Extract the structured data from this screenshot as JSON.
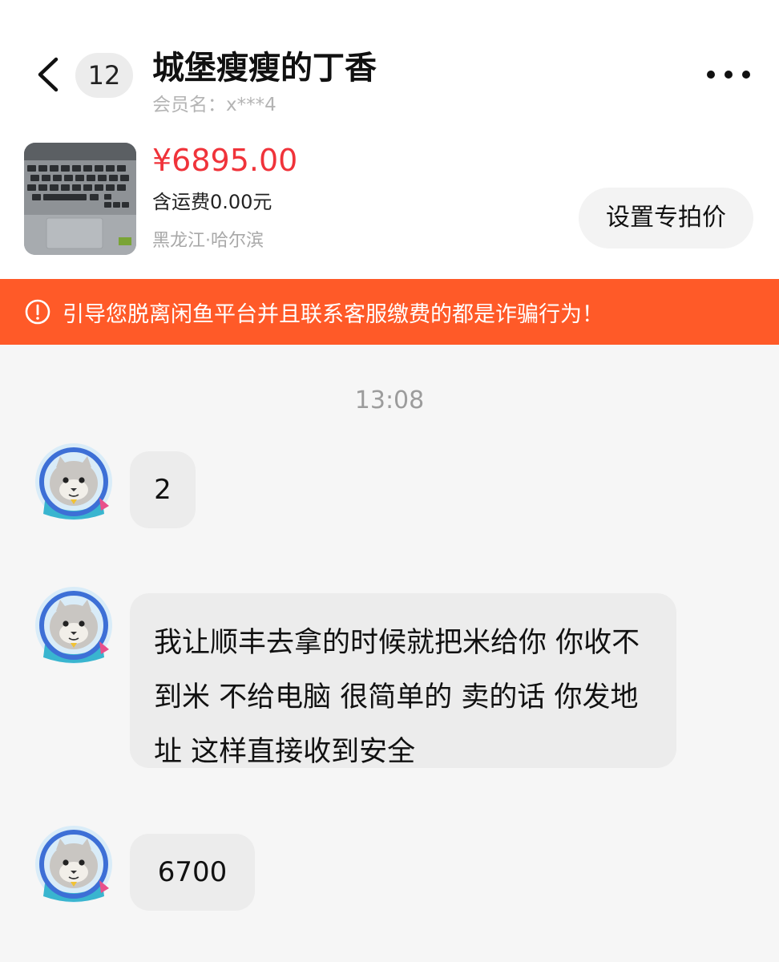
{
  "header": {
    "unread_count": "12",
    "title": "城堡瘦瘦的丁香",
    "member_name": "会员名：x***4"
  },
  "product": {
    "price": "¥6895.00",
    "shipping": "含运费0.00元",
    "location": "黑龙江·哈尔滨",
    "set_price_label": "设置专拍价"
  },
  "warning": {
    "text": "引导您脱离闲鱼平台并且联系客服缴费的都是诈骗行为！",
    "color": "#ff5a28"
  },
  "chat": {
    "timestamp": "13:08",
    "messages": [
      {
        "text": "2"
      },
      {
        "text": "我让顺丰去拿的时候就把米给你 你收不到米 不给电脑 很简单的 卖的话 你发地址 这样直接收到安全"
      },
      {
        "text": "6700"
      }
    ]
  },
  "icons": {
    "back": "chevron-left-icon",
    "more": "more-dots-icon",
    "warning": "exclamation-circle-icon",
    "avatar": "cat-astronaut-avatar"
  },
  "colors": {
    "price": "#f0333a",
    "bubble": "#ececec",
    "background": "#f6f6f6"
  }
}
